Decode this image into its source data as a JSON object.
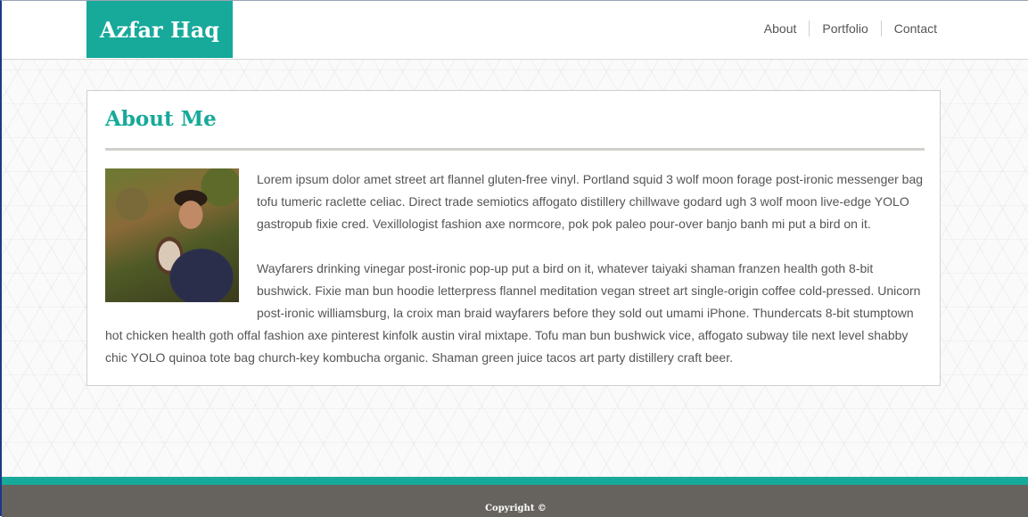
{
  "header": {
    "brand": "Azfar Haq",
    "nav": [
      "About",
      "Portfolio",
      "Contact"
    ]
  },
  "main": {
    "title": "About Me",
    "paragraphs": [
      "Lorem ipsum dolor amet street art flannel gluten-free vinyl. Portland squid 3 wolf moon forage post-ironic messenger bag tofu tumeric raclette celiac. Direct trade semiotics affogato distillery chillwave godard ugh 3 wolf moon live-edge YOLO gastropub fixie cred. Vexillologist fashion axe normcore, pok pok paleo pour-over banjo banh mi put a bird on it.",
      "Wayfarers drinking vinegar post-ironic pop-up put a bird on it, whatever taiyaki shaman franzen health goth 8-bit bushwick. Fixie man bun hoodie letterpress flannel meditation vegan street art single-origin coffee cold-pressed. Unicorn post-ironic williamsburg, la croix man braid wayfarers before they sold out umami iPhone. Thundercats 8-bit stumptown hot chicken health goth offal fashion axe pinterest kinfolk austin viral mixtape. Tofu man bun bushwick vice, affogato subway tile next level shabby chic YOLO quinoa tote bag church-key kombucha organic. Shaman green juice tacos art party distillery craft beer."
    ]
  },
  "footer": {
    "copyright": "Copyright ©"
  },
  "colors": {
    "accent": "#17a99a",
    "footer_bg": "#66625e",
    "text": "#555555"
  }
}
